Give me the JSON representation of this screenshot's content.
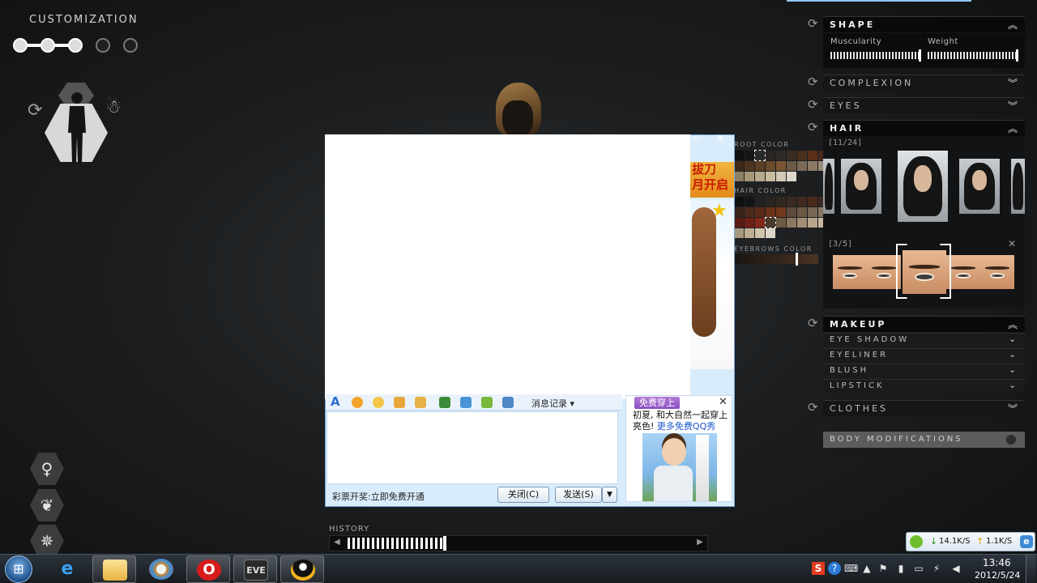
{
  "game": {
    "customization_title": "CUSTOMIZATION",
    "steps_total": 5,
    "steps_active": 3,
    "history_label": "HISTORY",
    "history_progress": 0.28
  },
  "right_panel": {
    "shape": {
      "title": "SHAPE",
      "muscularity_label": "Muscularity",
      "muscularity_value": 1.0,
      "weight_label": "Weight",
      "weight_value": 1.0
    },
    "complexion": "COMPLEXION",
    "eyes": "EYES",
    "hair": {
      "title": "HAIR",
      "style_counter": "[11/24]",
      "eyebrow_counter": "[3/5]"
    },
    "makeup": {
      "title": "MAKEUP",
      "items": [
        "EYE SHADOW",
        "EYELINER",
        "BLUSH",
        "LIPSTICK"
      ]
    },
    "clothes": "CLOTHES",
    "body_modifications": "BODY MODIFICATIONS"
  },
  "color_picker": {
    "root_label": "ROOT COLOR",
    "hair_label": "HAIR COLOR",
    "eyebrows_label": "EYEBROWS COLOR"
  },
  "qq_window": {
    "banner_text_1": "拔刀",
    "banner_text_2": "月开启",
    "history_btn": "消息记录",
    "status_text": "彩票开奖:立即免费开通",
    "close_btn": "关闭(C)",
    "send_btn": "发送(S)",
    "ad_tag": "免费穿上",
    "ad_text": "初夏, 和大自然一起穿上亮色! ",
    "ad_link": "更多免费QQ秀"
  },
  "netmeter": {
    "down": "14.1K/S",
    "up": "1.1K/S"
  },
  "taskbar": {
    "apps": [
      "internet-explorer",
      "file-explorer",
      "paint",
      "opera",
      "eve-online",
      "qq"
    ],
    "time": "13:46",
    "date": "2012/5/24"
  },
  "colors": {
    "qq_frame": "#d9ecfb",
    "accent_blue": "#8ec7ff",
    "body_mod_bg": "#5c5c5c"
  }
}
